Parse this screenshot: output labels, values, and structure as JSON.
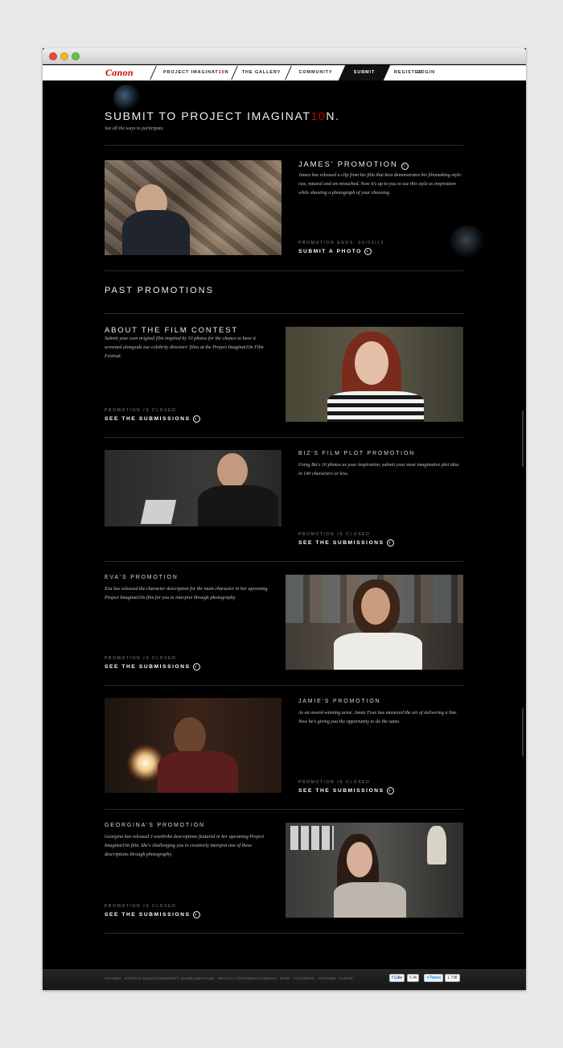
{
  "nav": {
    "logo": "Canon",
    "project_prefix": "PROJECT IMAGINAT",
    "project_accent": "10",
    "project_suffix": "N",
    "gallery": "THE GALLERY",
    "community": "COMMUNITY",
    "submit": "SUBMIT",
    "register": "REGISTER",
    "login": "LOGIN"
  },
  "header": {
    "title_prefix": "SUBMIT TO PROJECT IMAGINAT",
    "title_accent": "10",
    "title_suffix": "N.",
    "subtitle": "See all the ways to participate."
  },
  "current": {
    "heading": "JAMES' PROMOTION",
    "description": "James has released a clip from his film that best demonstrates his filmmaking style: raw, natural and un-retouched. Now it's up to you to use this style as inspiration while shooting a photograph of your choosing.",
    "ends": "PROMOTION ENDS: 09/03/13",
    "action": "SUBMIT A PHOTO"
  },
  "past_title": "PAST PROMOTIONS",
  "past": [
    {
      "heading": "ABOUT THE FILM CONTEST",
      "description": "Submit your own original film inspired by 10 photos for the chance to have it screened alongside our celebrity directors' films at the Project Imaginat10n Film Festival.",
      "status": "PROMOTION IS CLOSED",
      "action": "SEE THE SUBMISSIONS"
    },
    {
      "heading": "BIZ'S FILM PLOT PROMOTION",
      "description": "Using Biz's 10 photos as your inspiration, submit your most imaginative plot idea in 140 characters or less.",
      "status": "PROMOTION IS CLOSED",
      "action": "SEE THE SUBMISSIONS"
    },
    {
      "heading": "EVA'S PROMOTION",
      "description": "Eva has released the character description for the main character in her upcoming Project Imaginat10n film for you to interpret through photography.",
      "status": "PROMOTION IS CLOSED",
      "action": "SEE THE SUBMISSIONS"
    },
    {
      "heading": "JAMIE'S PROMOTION",
      "description": "As an award-winning actor, Jamie Foxx has mastered the art of delivering a line. Now he's giving you the opportunity to do the same.",
      "status": "PROMOTION IS CLOSED",
      "action": "SEE THE SUBMISSIONS"
    },
    {
      "heading": "GEORGINA'S PROMOTION",
      "description": "Georgina has released 3 wardrobe descriptions featured in her upcoming Project Imaginat10n film. She's challenging you to creatively interpret one of these descriptions through photography.",
      "status": "PROMOTION IS CLOSED",
      "action": "SEE THE SUBMISSIONS"
    }
  ],
  "footer": {
    "links": [
      "ANTHEM",
      "OFFICIAL RULES",
      "COMMUNITY GUIDELINES",
      "FAQS",
      "PRIVACY STATEMENT",
      "CAMERAS",
      "SHOP",
      "FACEBOOK",
      "YOUTUBE",
      "FLICKR"
    ],
    "like_label": "Like",
    "like_count": "5.4k",
    "tweet_label": "Tweet",
    "tweet_count": "1,798"
  },
  "colors": {
    "accent": "#cc0000",
    "background": "#000000",
    "nav_background": "#ffffff"
  }
}
